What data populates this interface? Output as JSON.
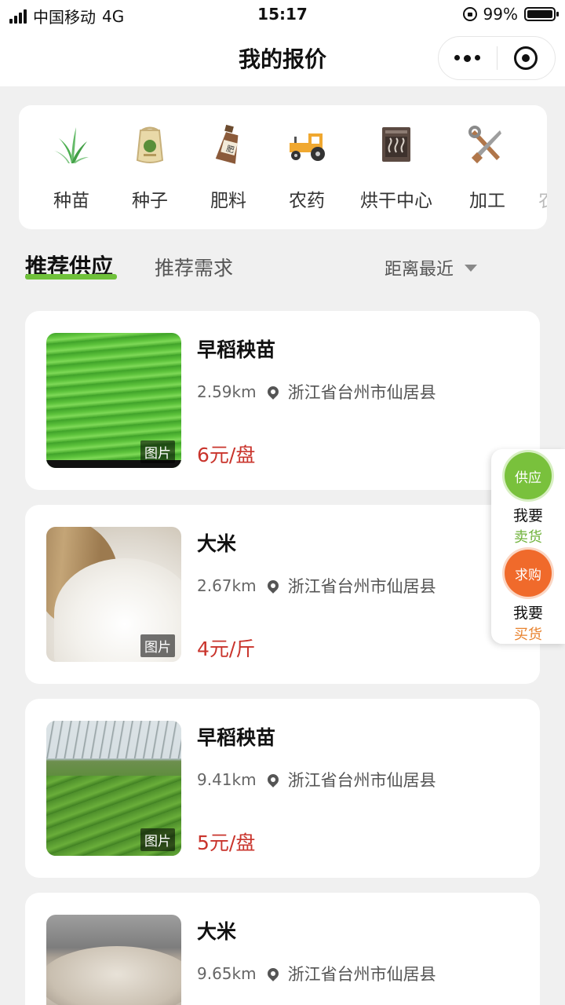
{
  "status_bar": {
    "carrier": "中国移动",
    "network": "4G",
    "time": "15:17",
    "battery": "99%",
    "battery_level": 0.99
  },
  "nav": {
    "title": "我的报价"
  },
  "categories": [
    {
      "label": "种苗",
      "icon": "seedling-icon"
    },
    {
      "label": "种子",
      "icon": "seed-bag-icon"
    },
    {
      "label": "肥料",
      "icon": "fertilizer-bottle-icon"
    },
    {
      "label": "农药",
      "icon": "tractor-icon"
    },
    {
      "label": "烘干中心",
      "icon": "dryer-icon"
    },
    {
      "label": "加工",
      "icon": "tools-icon"
    },
    {
      "label": "农",
      "icon": "partial-icon"
    }
  ],
  "tabs": {
    "active": "推荐供应",
    "inactive": "推荐需求",
    "sort": "距离最近"
  },
  "products": [
    {
      "name": "早稻秧苗",
      "distance": "2.59km",
      "address": "浙江省台州市仙居县",
      "price": "6元/盘",
      "image_tag": "图片",
      "image": "rice-seedlings-field"
    },
    {
      "name": "大米",
      "distance": "2.67km",
      "address": "浙江省台州市仙居县",
      "price": "4元/斤",
      "image_tag": "图片",
      "image": "rice-sack"
    },
    {
      "name": "早稻秧苗",
      "distance": "9.41km",
      "address": "浙江省台州市仙居县",
      "price": "5元/盘",
      "image_tag": "图片",
      "image": "greenhouse-seedlings"
    },
    {
      "name": "大米",
      "distance": "9.65km",
      "address": "浙江省台州市仙居县",
      "price": "",
      "image_tag": "",
      "image": "rice-bowl"
    }
  ],
  "float_panel": {
    "supply": {
      "circle": "供应",
      "line1": "我要",
      "line2": "卖货"
    },
    "demand": {
      "circle": "求购",
      "line1": "我要",
      "line2": "买货"
    }
  },
  "colors": {
    "accent_green": "#6fc13a",
    "accent_orange": "#f06a2b",
    "price_red": "#c9342c"
  }
}
